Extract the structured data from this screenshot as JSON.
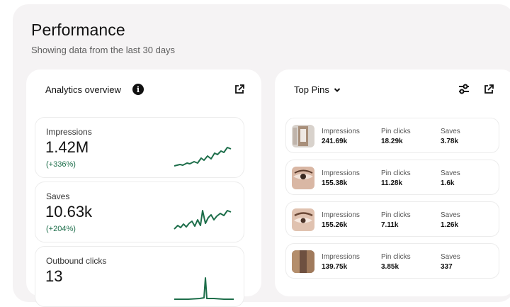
{
  "header": {
    "title": "Performance",
    "subtitle": "Showing data from the last 30 days"
  },
  "overview": {
    "title": "Analytics overview",
    "info_icon": "info-icon",
    "open_icon": "external-link-icon",
    "metrics": [
      {
        "label": "Impressions",
        "value": "1.42M",
        "change": "(+336%)"
      },
      {
        "label": "Saves",
        "value": "10.63k",
        "change": "(+204%)"
      },
      {
        "label": "Outbound clicks",
        "value": "13",
        "change": ""
      }
    ]
  },
  "top_pins": {
    "title": "Top Pins",
    "filter_icon": "sliders-icon",
    "open_icon": "external-link-icon",
    "columns": [
      "Impressions",
      "Pin clicks",
      "Saves"
    ],
    "rows": [
      {
        "impressions": "241.69k",
        "pin_clicks": "18.29k",
        "saves": "3.78k"
      },
      {
        "impressions": "155.38k",
        "pin_clicks": "11.28k",
        "saves": "1.6k"
      },
      {
        "impressions": "155.26k",
        "pin_clicks": "7.11k",
        "saves": "1.26k"
      },
      {
        "impressions": "139.75k",
        "pin_clicks": "3.85k",
        "saves": "337"
      }
    ]
  },
  "colors": {
    "sparkline": "#1d6e4a",
    "change_positive": "#1d6e4a"
  }
}
